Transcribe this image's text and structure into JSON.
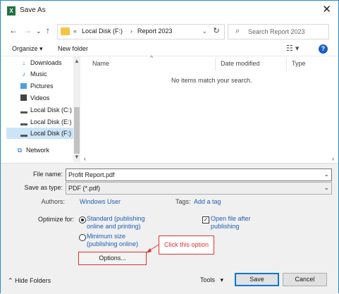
{
  "window": {
    "title": "Save As",
    "app_icon": "excel-icon"
  },
  "navbar": {
    "address_parts": [
      "Local Disk (F:)",
      "Report 2023"
    ],
    "search_placeholder": "Search Report 2023"
  },
  "toolbar": {
    "organize": "Organize ▾",
    "new_folder": "New folder"
  },
  "nav_pane": {
    "items": [
      {
        "label": "Downloads",
        "icon": "download-icon"
      },
      {
        "label": "Music",
        "icon": "music-icon"
      },
      {
        "label": "Pictures",
        "icon": "pictures-icon"
      },
      {
        "label": "Videos",
        "icon": "videos-icon"
      },
      {
        "label": "Local Disk (C:)",
        "icon": "drive-icon"
      },
      {
        "label": "Local Disk (E:)",
        "icon": "drive-icon"
      },
      {
        "label": "Local Disk (F:)",
        "icon": "drive-icon",
        "selected": true
      },
      {
        "label": "Network",
        "icon": "network-icon"
      }
    ]
  },
  "file_list": {
    "columns": [
      "Name",
      "Date modified",
      "Type"
    ],
    "empty_message": "No items match your search."
  },
  "form": {
    "file_name_label": "File name:",
    "file_name_value": "Profit Report.pdf",
    "save_as_type_label": "Save as type:",
    "save_as_type_value": "PDF (*.pdf)",
    "authors_label": "Authors:",
    "authors_value": "Windows User",
    "tags_label": "Tags:",
    "tags_value": "Add a tag",
    "optimize_label": "Optimize for:",
    "optimize_standard_line1": "Standard (publishing",
    "optimize_standard_line2": "online and printing)",
    "optimize_minimum_line1": "Minimum size",
    "optimize_minimum_line2": "(publishing online)",
    "open_after_line1": "Open file after",
    "open_after_line2": "publishing",
    "options_button": "Options..."
  },
  "annotation": {
    "callout_text": "Click this option",
    "color": "#e03131"
  },
  "footer": {
    "hide_folders": "Hide Folders",
    "tools": "Tools",
    "save": "Save",
    "cancel": "Cancel"
  }
}
